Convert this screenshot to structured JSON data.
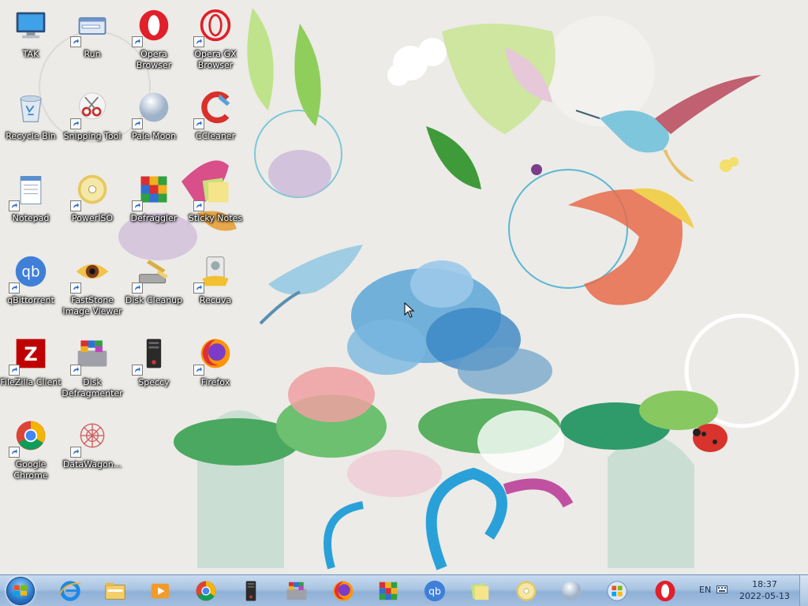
{
  "desktop": {
    "icons": [
      {
        "label": "TAK",
        "icon": "monitor-icon",
        "shortcut": false
      },
      {
        "label": "Run",
        "icon": "run-icon",
        "shortcut": true
      },
      {
        "label": "Opera Browser",
        "icon": "opera-icon",
        "shortcut": true
      },
      {
        "label": "Opera GX Browser",
        "icon": "opera-gx-icon",
        "shortcut": true
      },
      {
        "label": "Recycle Bin",
        "icon": "recycle-bin-icon",
        "shortcut": false
      },
      {
        "label": "Snipping Tool",
        "icon": "scissors-icon",
        "shortcut": true
      },
      {
        "label": "Pale Moon",
        "icon": "pale-moon-icon",
        "shortcut": true
      },
      {
        "label": "CCleaner",
        "icon": "ccleaner-icon",
        "shortcut": true
      },
      {
        "label": "Notepad",
        "icon": "notepad-icon",
        "shortcut": true
      },
      {
        "label": "PowerISO",
        "icon": "disc-icon",
        "shortcut": true
      },
      {
        "label": "Defraggler",
        "icon": "defraggler-icon",
        "shortcut": true
      },
      {
        "label": "Sticky Notes",
        "icon": "sticky-notes-icon",
        "shortcut": true
      },
      {
        "label": "qBittorrent",
        "icon": "qbittorrent-icon",
        "shortcut": true
      },
      {
        "label": "FastStone Image Viewer",
        "icon": "eye-icon",
        "shortcut": true
      },
      {
        "label": "Disk Cleanup",
        "icon": "disk-cleanup-icon",
        "shortcut": true
      },
      {
        "label": "Recuva",
        "icon": "recuva-icon",
        "shortcut": true
      },
      {
        "label": "FileZilla Client",
        "icon": "filezilla-icon",
        "shortcut": true
      },
      {
        "label": "Disk Defragmenter",
        "icon": "disk-defragmenter-icon",
        "shortcut": true
      },
      {
        "label": "Speccy",
        "icon": "speccy-icon",
        "shortcut": true
      },
      {
        "label": "Firefox",
        "icon": "firefox-icon",
        "shortcut": true
      },
      {
        "label": "Google Chrome",
        "icon": "chrome-icon",
        "shortcut": true
      },
      {
        "label": "DataWagon...",
        "icon": "datawagon-icon",
        "shortcut": true
      }
    ]
  },
  "taskbar": {
    "start_button": "start-orb-icon",
    "pinned": [
      "internet-explorer-icon",
      "file-explorer-icon",
      "media-player-icon",
      "chrome-icon",
      "speccy-icon",
      "disk-defragmenter-icon",
      "firefox-icon",
      "defraggler-icon",
      "qbittorrent-icon",
      "sticky-notes-icon",
      "disc-icon",
      "pale-moon-icon",
      "windows-update-icon",
      "opera-icon"
    ],
    "language": "EN",
    "time": "18:37",
    "date": "2022-05-13"
  },
  "colors": {
    "taskbar_top": "#c7dbef",
    "taskbar_bottom": "#a3bfe0",
    "label_text": "#ffffff",
    "opera_red": "#e0202a",
    "qbittorrent_blue": "#3f7fd8"
  }
}
